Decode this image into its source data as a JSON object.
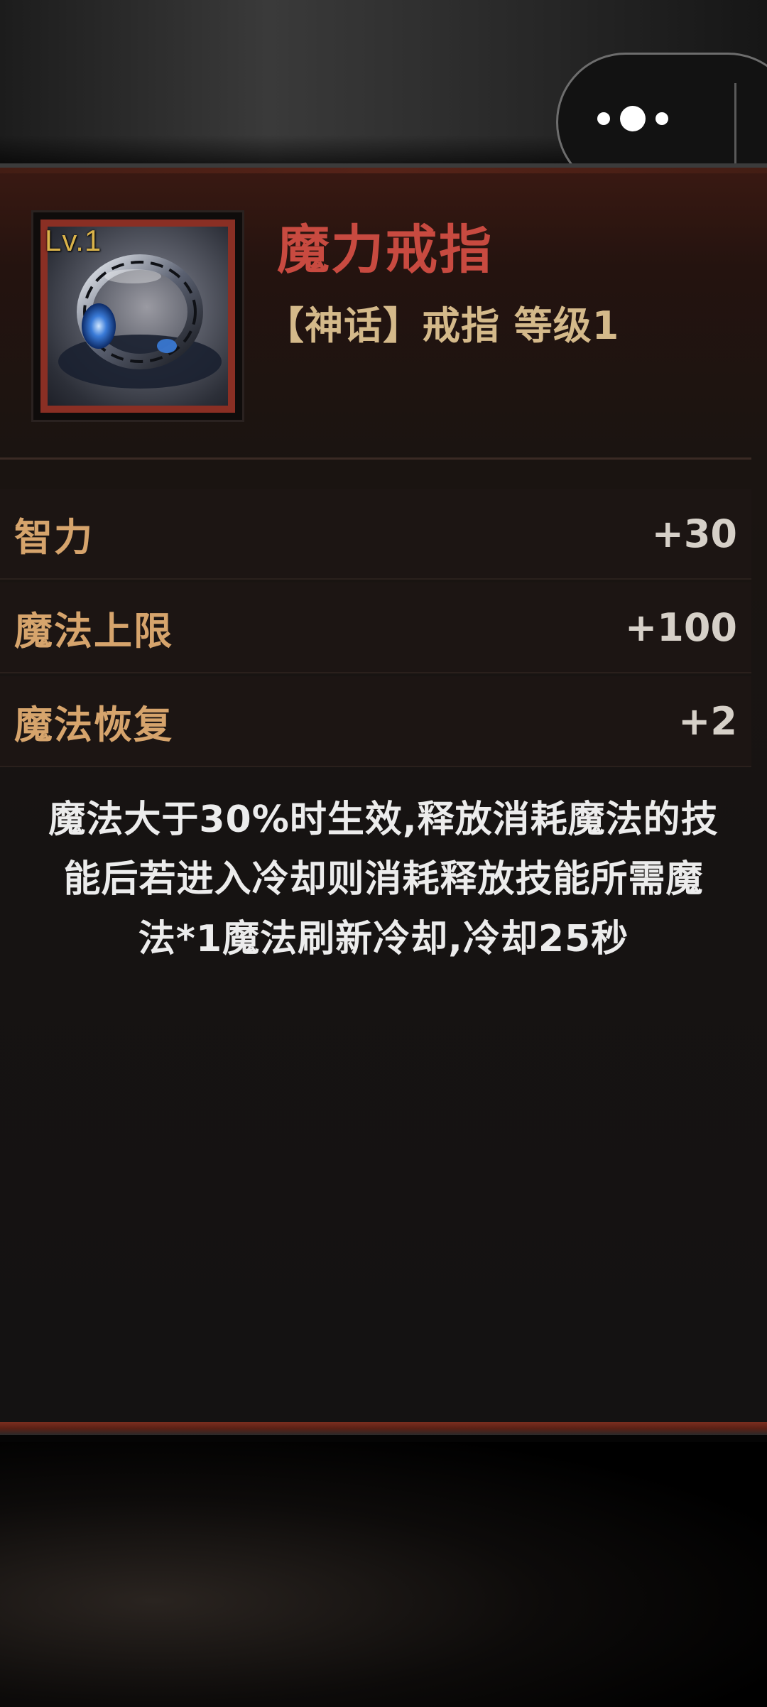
{
  "colors": {
    "item_name": "#c84a40",
    "item_type": "#d4b98a",
    "stat_name": "#d6a46c",
    "stat_value": "#d6d0c8",
    "description": "#ececec",
    "level_badge": "#d9b24a",
    "frame_border": "#8a2f24"
  },
  "capsule": {
    "more_icon": "more-dots-icon"
  },
  "item": {
    "icon": "magic-ring-icon",
    "level_badge": "Lv.1",
    "name": "魔力戒指",
    "type_line": "【神话】戒指 等级1"
  },
  "stats": [
    {
      "name": "智力",
      "value": "+30"
    },
    {
      "name": "魔法上限",
      "value": "+100"
    },
    {
      "name": "魔法恢复",
      "value": "+2"
    }
  ],
  "description": {
    "line1": "魔法大于30%时生效,释放消耗魔法的技",
    "line2": "能后若进入冷却则消耗释放技能所需魔",
    "line3": "法*1魔法刷新冷却,冷却25秒"
  }
}
